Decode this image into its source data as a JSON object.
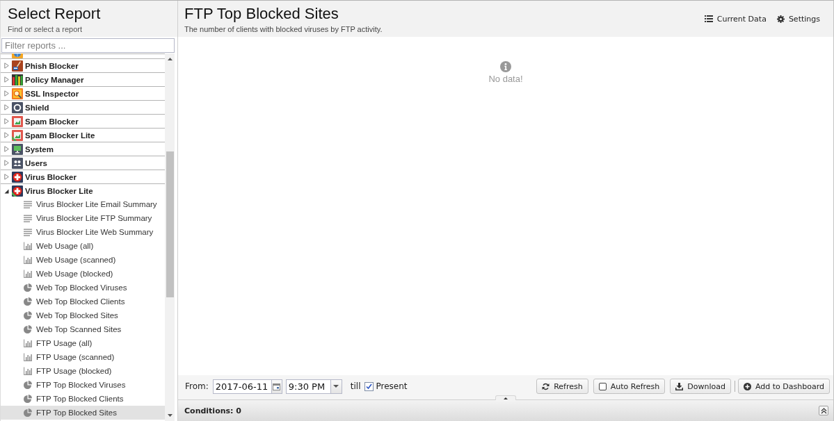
{
  "sidebar": {
    "title": "Select Report",
    "subtitle": "Find or select a report",
    "filter": {
      "placeholder": "Filter reports ..."
    },
    "tree": [
      {
        "kind": "globe",
        "clipped": true,
        "selected": false
      },
      {
        "label": "Phish Blocker",
        "kind": "hook",
        "clipped": false,
        "ribbon": false,
        "expanded": false,
        "selected": false
      },
      {
        "label": "Policy Manager",
        "kind": "bars",
        "clipped": false,
        "ribbon": false,
        "expanded": false,
        "selected": false
      },
      {
        "label": "SSL Inspector",
        "kind": "lens",
        "clipped": false,
        "ribbon": false,
        "expanded": false,
        "selected": false
      },
      {
        "label": "Shield",
        "kind": "ring",
        "clipped": false,
        "ribbon": false,
        "expanded": false,
        "selected": false
      },
      {
        "label": "Spam Blocker",
        "kind": "picture",
        "clipped": false,
        "ribbon": false,
        "expanded": false,
        "selected": false
      },
      {
        "label": "Spam Blocker Lite",
        "kind": "picture",
        "clipped": false,
        "ribbon": true,
        "expanded": false,
        "selected": false
      },
      {
        "label": "System",
        "kind": "monitor",
        "clipped": false,
        "ribbon": false,
        "expanded": false,
        "selected": false
      },
      {
        "label": "Users",
        "kind": "people",
        "clipped": false,
        "ribbon": false,
        "expanded": false,
        "selected": false
      },
      {
        "label": "Virus Blocker",
        "kind": "cross",
        "clipped": false,
        "ribbon": false,
        "expanded": false,
        "selected": false
      },
      {
        "label": "Virus Blocker Lite",
        "kind": "cross",
        "clipped": false,
        "ribbon": true,
        "expanded": true,
        "selected": false,
        "children": [
          {
            "label": "Virus Blocker Lite Email Summary",
            "kind": "summary",
            "selected": false
          },
          {
            "label": "Virus Blocker Lite FTP Summary",
            "kind": "summary",
            "selected": false
          },
          {
            "label": "Virus Blocker Lite Web Summary",
            "kind": "summary",
            "selected": false
          },
          {
            "label": "Web Usage (all)",
            "kind": "bar",
            "selected": false
          },
          {
            "label": "Web Usage (scanned)",
            "kind": "bar",
            "selected": false
          },
          {
            "label": "Web Usage (blocked)",
            "kind": "bar",
            "selected": false
          },
          {
            "label": "Web Top Blocked Viruses",
            "kind": "pie",
            "selected": false
          },
          {
            "label": "Web Top Blocked Clients",
            "kind": "pie",
            "selected": false
          },
          {
            "label": "Web Top Blocked Sites",
            "kind": "pie",
            "selected": false
          },
          {
            "label": "Web Top Scanned Sites",
            "kind": "pie",
            "selected": false
          },
          {
            "label": "FTP Usage (all)",
            "kind": "bar",
            "selected": false
          },
          {
            "label": "FTP Usage (scanned)",
            "kind": "bar",
            "selected": false
          },
          {
            "label": "FTP Usage (blocked)",
            "kind": "bar",
            "selected": false
          },
          {
            "label": "FTP Top Blocked Viruses",
            "kind": "pie",
            "selected": false
          },
          {
            "label": "FTP Top Blocked Clients",
            "kind": "pie",
            "selected": false
          },
          {
            "label": "FTP Top Blocked Sites",
            "kind": "pie",
            "selected": true
          }
        ]
      }
    ]
  },
  "report": {
    "title": "FTP Top Blocked Sites",
    "subtitle": "The number of clients with blocked viruses by FTP activity.",
    "actions": [
      {
        "label": "Current Data",
        "kind": "list"
      },
      {
        "label": "Settings",
        "kind": "gear"
      }
    ],
    "empty_message": "No data!"
  },
  "toolbar": {
    "from_label": "From:",
    "date": "2017-06-11",
    "time": "9:30 PM",
    "till_label": "till",
    "present": {
      "label": "Present",
      "checked": true
    },
    "buttons": [
      {
        "label": "Refresh",
        "kind": "refresh"
      },
      {
        "label": "Auto Refresh",
        "kind": "toggle",
        "checked": false
      },
      {
        "label": "Download",
        "kind": "download"
      },
      {
        "label": "Add to Dashboard",
        "kind": "add"
      }
    ]
  },
  "conditions": {
    "label": "Conditions: 0",
    "expanded": false
  }
}
